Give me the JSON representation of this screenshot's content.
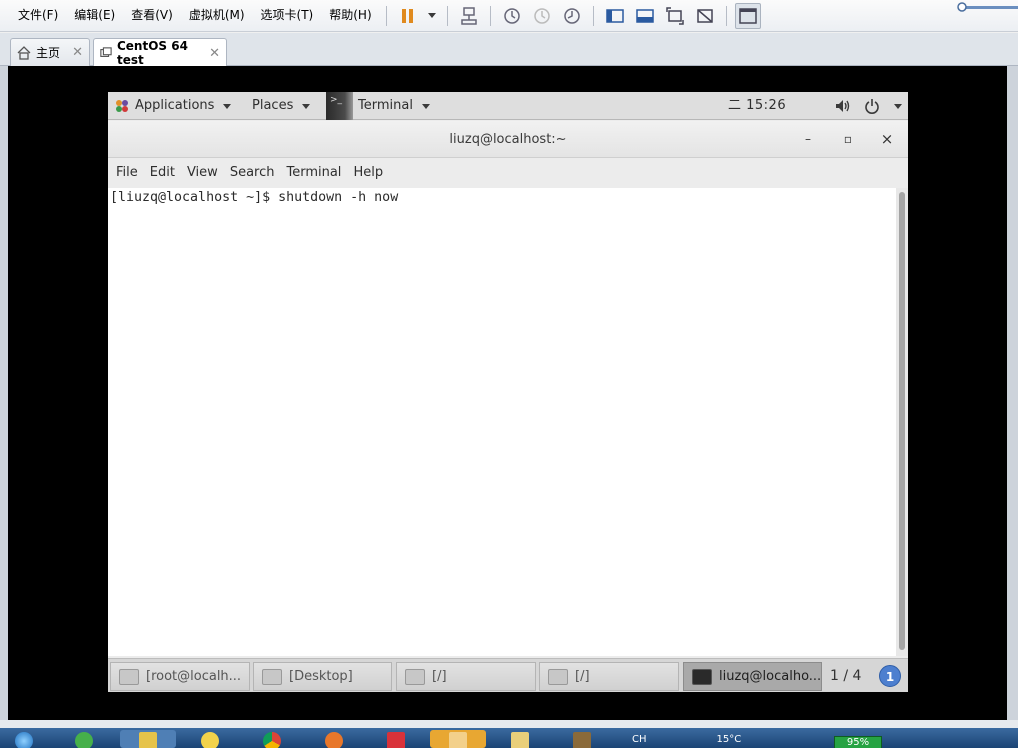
{
  "vm_menubar": {
    "items": [
      "文件(F)",
      "编辑(E)",
      "查看(V)",
      "虚拟机(M)",
      "选项卡(T)",
      "帮助(H)"
    ]
  },
  "vm_tabs": {
    "home_label": "主页",
    "vm_label": "CentOS 64 test"
  },
  "gnome_top": {
    "applications": "Applications",
    "places": "Places",
    "terminal": "Terminal",
    "clock": "二 15:26"
  },
  "terminal": {
    "title": "liuzq@localhost:~",
    "minimize": "–",
    "maximize": "▫",
    "close": "×",
    "menu": [
      "File",
      "Edit",
      "View",
      "Search",
      "Terminal",
      "Help"
    ],
    "prompt_line": "[liuzq@localhost ~]$ shutdown -h now"
  },
  "window_list": {
    "items": [
      "[root@localh...",
      "[Desktop]",
      "[/]",
      "[/]",
      "liuzq@localho..."
    ],
    "workspace": "1 / 4",
    "badge": "1"
  },
  "tray": {
    "items": [
      "CH",
      "15°C"
    ],
    "battery": "95%"
  },
  "colors": {
    "vm_background": "#000000",
    "gnome_panel": "#dedede",
    "active_window_item": "#a9a9a9",
    "workspace_badge": "#4d7fcf",
    "taskbar": "#1b4474"
  }
}
